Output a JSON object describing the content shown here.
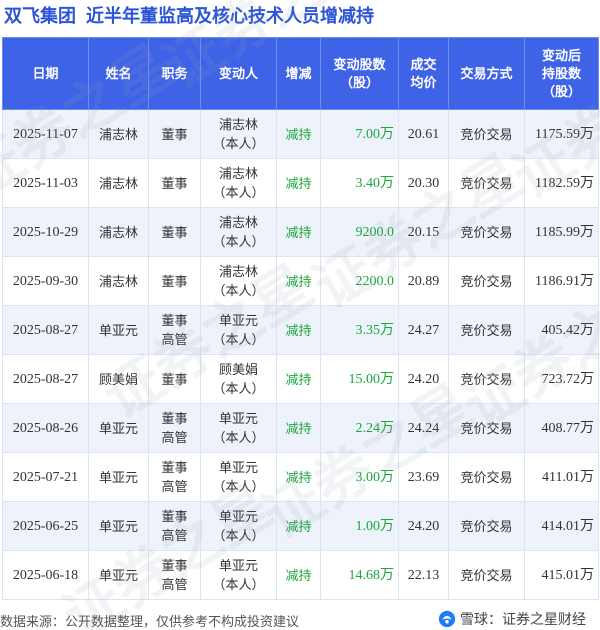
{
  "header": {
    "company": "双飞集团",
    "subtitle": "近半年董监高及核心技术人员增减持"
  },
  "table": {
    "columns": [
      {
        "key": "date",
        "lines": [
          "日期"
        ]
      },
      {
        "key": "name",
        "lines": [
          "姓名"
        ]
      },
      {
        "key": "position",
        "lines": [
          "职务"
        ]
      },
      {
        "key": "actor",
        "lines": [
          "变动人"
        ]
      },
      {
        "key": "direction",
        "lines": [
          "增减"
        ]
      },
      {
        "key": "shares",
        "lines": [
          "变动股数",
          "（股）"
        ]
      },
      {
        "key": "price",
        "lines": [
          "成交",
          "均价"
        ]
      },
      {
        "key": "mode",
        "lines": [
          "交易方式"
        ]
      },
      {
        "key": "after",
        "lines": [
          "变动后",
          "持股数",
          "（股）"
        ]
      }
    ],
    "rows": [
      {
        "date": "2025-11-07",
        "name": "浦志林",
        "position": [
          "董事"
        ],
        "actor": [
          "浦志林",
          "（本人）"
        ],
        "direction": "减持",
        "shares": "7.00万",
        "price": "20.61",
        "mode": "竞价交易",
        "after": "1175.59万"
      },
      {
        "date": "2025-11-03",
        "name": "浦志林",
        "position": [
          "董事"
        ],
        "actor": [
          "浦志林",
          "（本人）"
        ],
        "direction": "减持",
        "shares": "3.40万",
        "price": "20.30",
        "mode": "竞价交易",
        "after": "1182.59万"
      },
      {
        "date": "2025-10-29",
        "name": "浦志林",
        "position": [
          "董事"
        ],
        "actor": [
          "浦志林",
          "（本人）"
        ],
        "direction": "减持",
        "shares": "9200.0",
        "price": "20.15",
        "mode": "竞价交易",
        "after": "1185.99万"
      },
      {
        "date": "2025-09-30",
        "name": "浦志林",
        "position": [
          "董事"
        ],
        "actor": [
          "浦志林",
          "（本人）"
        ],
        "direction": "减持",
        "shares": "2200.0",
        "price": "20.89",
        "mode": "竞价交易",
        "after": "1186.91万"
      },
      {
        "date": "2025-08-27",
        "name": "单亚元",
        "position": [
          "董事",
          "高管"
        ],
        "actor": [
          "单亚元",
          "（本人）"
        ],
        "direction": "减持",
        "shares": "3.35万",
        "price": "24.27",
        "mode": "竞价交易",
        "after": "405.42万"
      },
      {
        "date": "2025-08-27",
        "name": "顾美娟",
        "position": [
          "董事"
        ],
        "actor": [
          "顾美娟",
          "（本人）"
        ],
        "direction": "减持",
        "shares": "15.00万",
        "price": "24.20",
        "mode": "竞价交易",
        "after": "723.72万"
      },
      {
        "date": "2025-08-26",
        "name": "单亚元",
        "position": [
          "董事",
          "高管"
        ],
        "actor": [
          "单亚元",
          "（本人）"
        ],
        "direction": "减持",
        "shares": "2.24万",
        "price": "24.24",
        "mode": "竞价交易",
        "after": "408.77万"
      },
      {
        "date": "2025-07-21",
        "name": "单亚元",
        "position": [
          "董事",
          "高管"
        ],
        "actor": [
          "单亚元",
          "（本人）"
        ],
        "direction": "减持",
        "shares": "3.00万",
        "price": "23.69",
        "mode": "竞价交易",
        "after": "411.01万"
      },
      {
        "date": "2025-06-25",
        "name": "单亚元",
        "position": [
          "董事",
          "高管"
        ],
        "actor": [
          "单亚元",
          "（本人）"
        ],
        "direction": "减持",
        "shares": "1.00万",
        "price": "24.20",
        "mode": "竞价交易",
        "after": "414.01万"
      },
      {
        "date": "2025-06-18",
        "name": "单亚元",
        "position": [
          "董事",
          "高管"
        ],
        "actor": [
          "单亚元",
          "（本人）"
        ],
        "direction": "减持",
        "shares": "14.68万",
        "price": "22.13",
        "mode": "竞价交易",
        "after": "415.01万"
      }
    ]
  },
  "watermark": {
    "text": "证券之星"
  },
  "footer": {
    "source": "数据来源：公开数据整理，仅供参考不构成投资建议",
    "brand": "雪球：证券之星财经"
  },
  "colors": {
    "header_bg": "#3f63e6",
    "title": "#2b55d6",
    "reduce_green": "#18a83b",
    "row_stripe": "#eef2fa"
  },
  "icons": {
    "brand": "snowball-icon"
  }
}
